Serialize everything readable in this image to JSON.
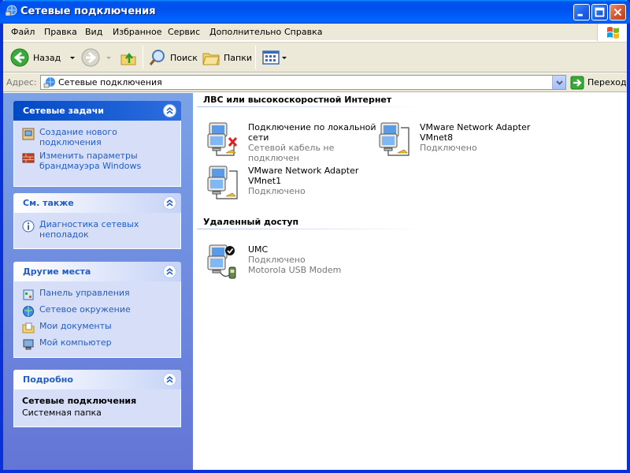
{
  "window": {
    "title": "Сетевые подключения"
  },
  "menu": [
    "Файл",
    "Правка",
    "Вид",
    "Избранное",
    "Сервис",
    "Дополнительно",
    "Справка"
  ],
  "toolbar": {
    "back_label": "Назад",
    "search_label": "Поиск",
    "folders_label": "Папки"
  },
  "address": {
    "label": "Адрес:",
    "value": "Сетевые подключения",
    "go_label": "Переход"
  },
  "taskpane": {
    "network_tasks": {
      "title": "Сетевые задачи",
      "items": [
        "Создание нового подключения",
        "Изменить параметры брандмауэра Windows"
      ]
    },
    "see_also": {
      "title": "См. также",
      "items": [
        "Диагностика сетевых неполадок"
      ]
    },
    "other_places": {
      "title": "Другие места",
      "items": [
        "Панель управления",
        "Сетевое окружение",
        "Мои документы",
        "Мой компьютер"
      ]
    },
    "details": {
      "title": "Подробно",
      "name": "Сетевые подключения",
      "type": "Системная папка"
    }
  },
  "groups": {
    "lan": {
      "title": "ЛВС или высокоскоростной Интернет",
      "connections": [
        {
          "name1": "Подключение по локальной",
          "name2": "сети",
          "status": "Сетевой кабель не подключен"
        },
        {
          "name1": "VMware Network Adapter",
          "name2": "VMnet8",
          "status": "Подключено"
        },
        {
          "name1": "VMware Network Adapter",
          "name2": "VMnet1",
          "status": "Подключено"
        }
      ]
    },
    "dialup": {
      "title": "Удаленный доступ",
      "connections": [
        {
          "name1": "UMC",
          "status": "Подключено",
          "device": "Motorola USB Modem"
        }
      ]
    }
  },
  "colors": {
    "titlebar": "#0053ee",
    "taskpane_bg": "#7ba2e7",
    "link": "#215dc6"
  }
}
